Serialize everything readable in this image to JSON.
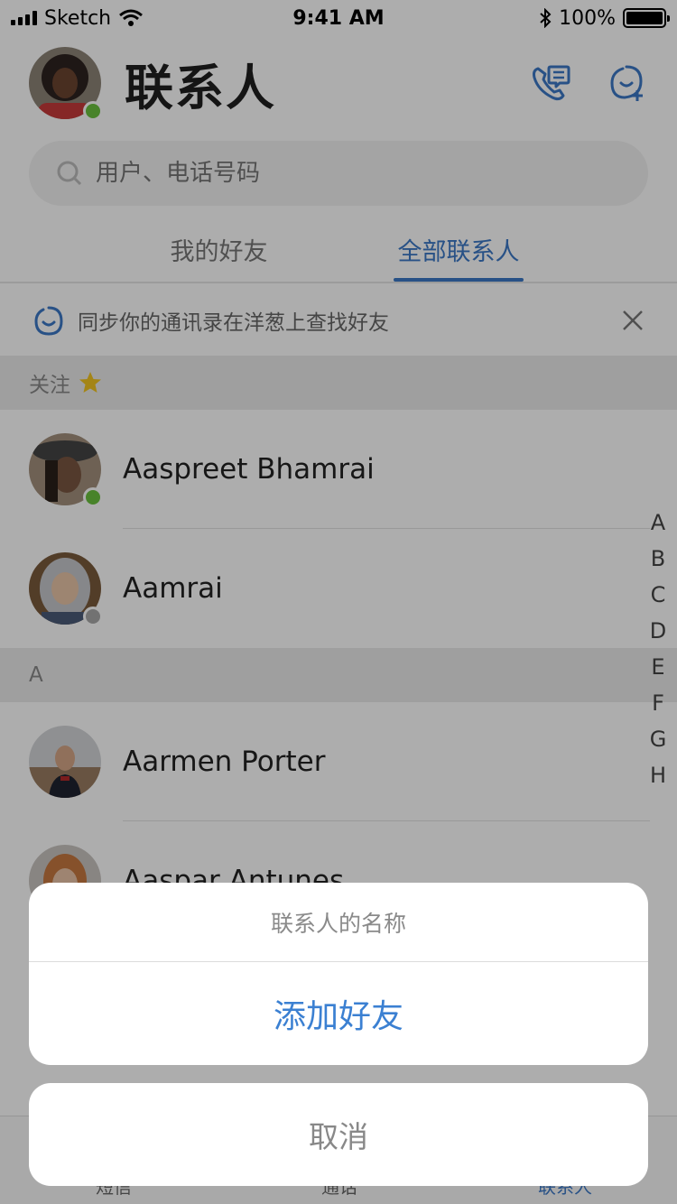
{
  "status_bar": {
    "carrier": "Sketch",
    "time": "9:41 AM",
    "battery": "100%",
    "battery_level": 1.0
  },
  "header": {
    "title": "联系人",
    "presence_color": "#6ac13f",
    "call_icon": "phone-chat-icon",
    "add_icon": "add-contact-icon"
  },
  "search": {
    "placeholder": "用户、电话号码"
  },
  "tabs": [
    {
      "label": "我的好友",
      "active": false
    },
    {
      "label": "全部联系人",
      "active": true
    }
  ],
  "sync_banner": {
    "text": "同步你的通讯录在洋葱上查找好友"
  },
  "sections": [
    {
      "title": "关注",
      "icon": "star-icon",
      "contacts": [
        {
          "name": "Aaspreet Bhamrai",
          "status": "online"
        },
        {
          "name": "Aamrai",
          "status": "offline"
        }
      ]
    },
    {
      "title": "A",
      "contacts": [
        {
          "name": "Aarmen Porter"
        },
        {
          "name": "Aaspar Antunes"
        }
      ]
    }
  ],
  "index_letters": [
    "A",
    "B",
    "C",
    "D",
    "E",
    "F",
    "G",
    "H"
  ],
  "tabbar": [
    {
      "label": "短信",
      "active": false
    },
    {
      "label": "通话",
      "active": false
    },
    {
      "label": "联系人",
      "active": true
    }
  ],
  "action_sheet": {
    "title": "联系人的名称",
    "action": "添加好友",
    "cancel": "取消"
  },
  "colors": {
    "accent": "#3b78c6",
    "online": "#6ac13f",
    "offline": "#a8a8a8",
    "star": "#f2c521"
  }
}
